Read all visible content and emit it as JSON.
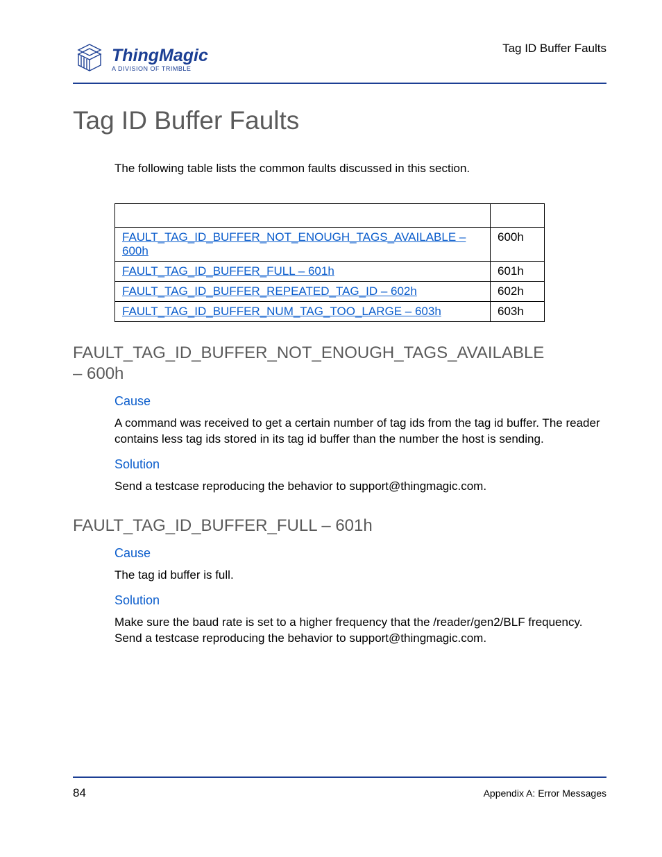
{
  "header": {
    "section_label": "Tag ID Buffer Faults",
    "logo_brand": "ThingMagic",
    "logo_sub": "A DIVISION OF TRIMBLE"
  },
  "title": "Tag ID Buffer Faults",
  "intro": "The following table lists the common faults discussed in this section.",
  "table": {
    "rows": [
      {
        "name": "FAULT_TAG_ID_BUFFER_NOT_ENOUGH_TAGS_AVAILABLE – 600h",
        "code": "600h"
      },
      {
        "name": "FAULT_TAG_ID_BUFFER_FULL – 601h",
        "code": "601h"
      },
      {
        "name": "FAULT_TAG_ID_BUFFER_REPEATED_TAG_ID – 602h",
        "code": "602h"
      },
      {
        "name": "FAULT_TAG_ID_BUFFER_NUM_TAG_TOO_LARGE – 603h",
        "code": "603h"
      }
    ]
  },
  "sections": [
    {
      "heading": "FAULT_TAG_ID_BUFFER_NOT_ENOUGH_TAGS_AVAILABLE – 600h",
      "cause_label": "Cause",
      "cause_text": "A command was received to get a certain number of tag ids from the tag id buffer. The reader contains less tag ids stored in its tag id buffer than the number the host is sending.",
      "solution_label": "Solution",
      "solution_text": "Send a testcase reproducing the behavior to support@thingmagic.com."
    },
    {
      "heading": "FAULT_TAG_ID_BUFFER_FULL – 601h",
      "cause_label": "Cause",
      "cause_text": "The tag id buffer is full.",
      "solution_label": "Solution",
      "solution_text": "Make sure the baud rate is set to a higher frequency that the /reader/gen2/BLF frequency. Send a testcase reproducing the behavior to support@thingmagic.com."
    }
  ],
  "footer": {
    "page": "84",
    "label": "Appendix A: Error Messages"
  }
}
